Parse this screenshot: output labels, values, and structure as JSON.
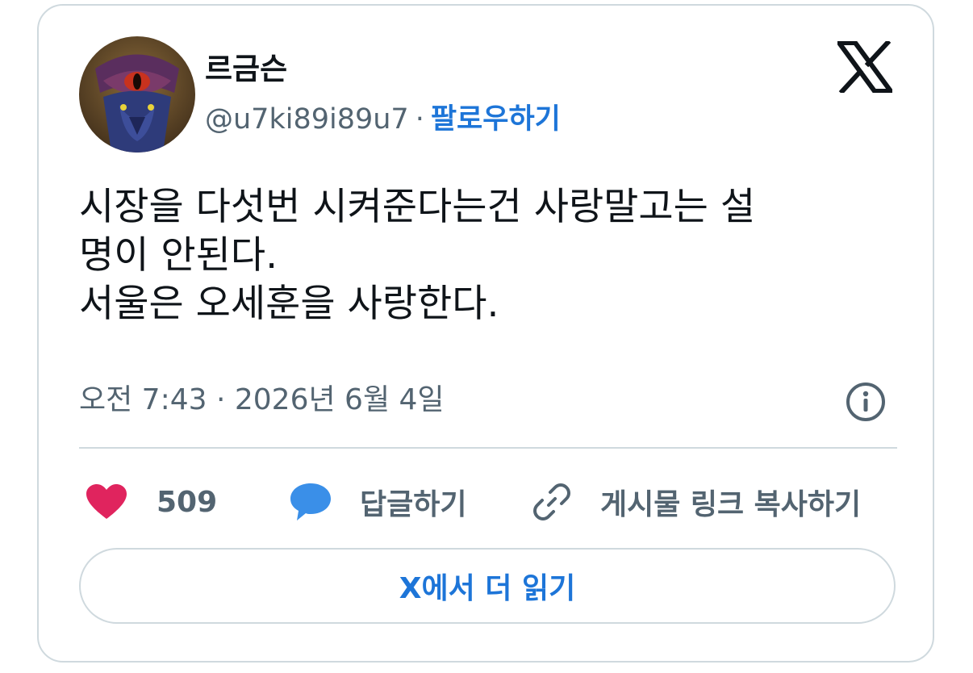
{
  "author": {
    "display_name": "르금슨",
    "handle": "@u7ki89i89u7",
    "separator": "·",
    "follow_label": "팔로우하기"
  },
  "brand": {
    "logo_icon": "x-logo-icon"
  },
  "tweet": {
    "lines": [
      "시장을 다섯번 시켜준다는건 사랑말고는 설",
      "명이 안된다.",
      "서울은 오세훈을 사랑한다."
    ],
    "timestamp": "오전 7:43 · 2026년 6월 4일"
  },
  "actions": {
    "like_count": "509",
    "reply_label": "답글하기",
    "copy_link_label": "게시물 링크 복사하기"
  },
  "footer": {
    "read_more_label": "X에서 더 읽기"
  },
  "colors": {
    "like": "#e0245e",
    "reply": "#3a8fe8",
    "link_accent": "#1d75d8",
    "muted": "#536471",
    "text": "#0f1419",
    "border": "#cfd9de"
  }
}
